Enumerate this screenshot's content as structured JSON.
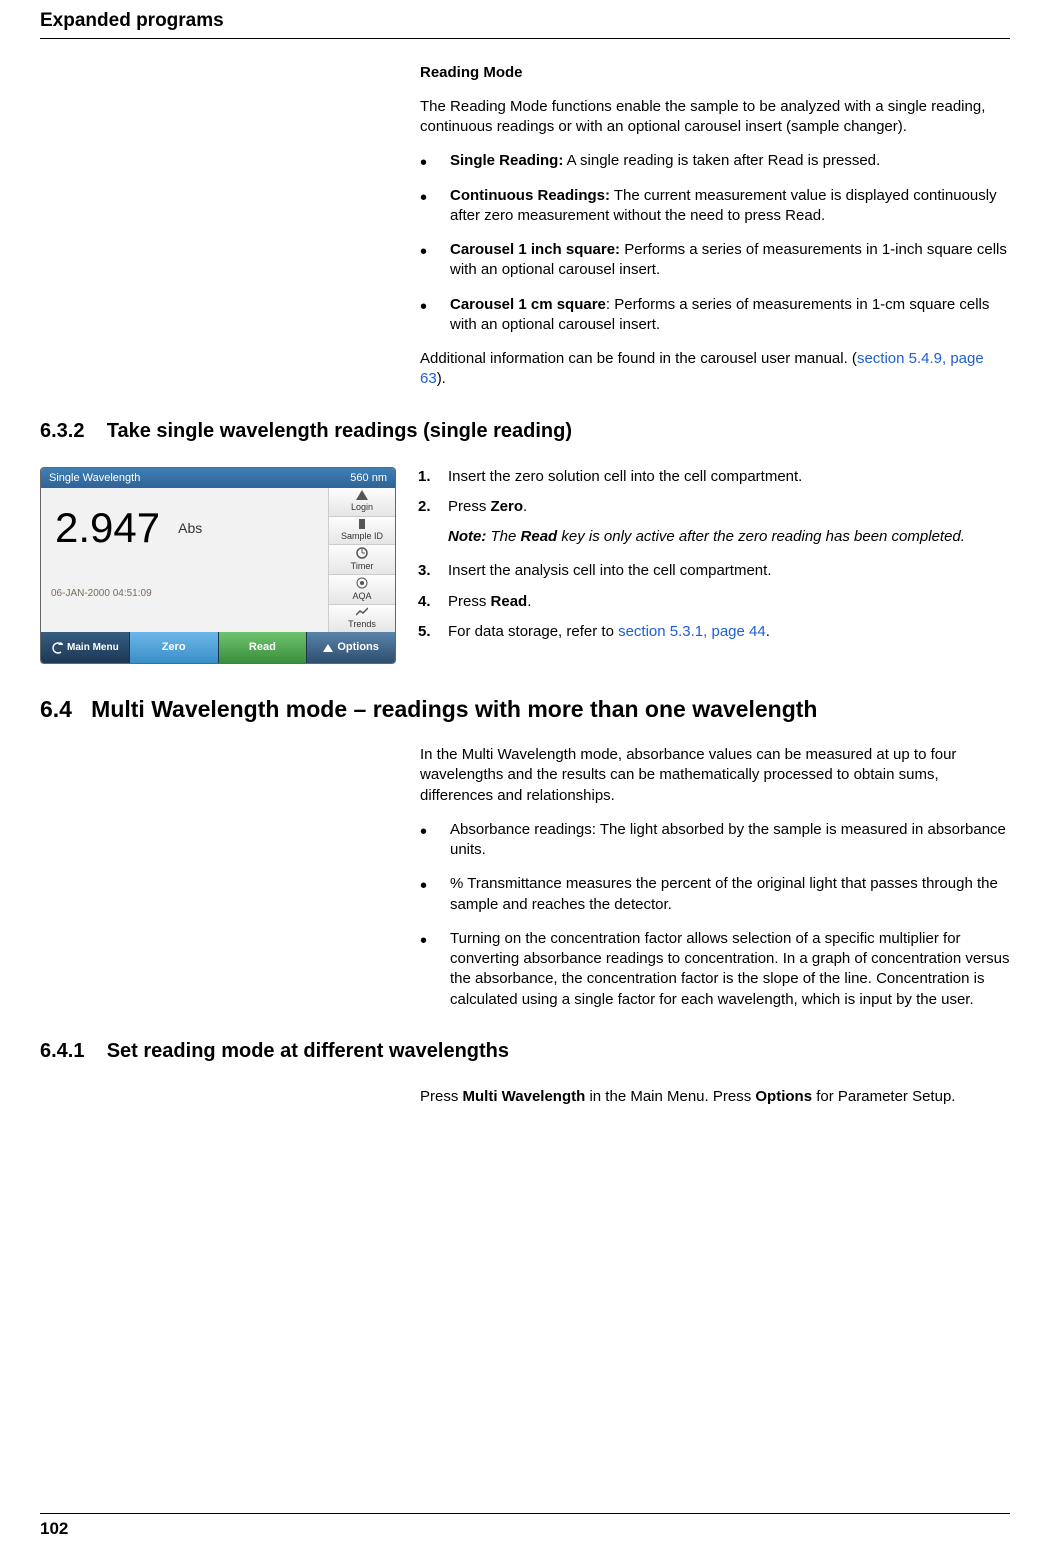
{
  "header_title": "Expanded programs",
  "page_number": "102",
  "reading_mode": {
    "title": "Reading Mode",
    "intro": "The Reading Mode functions enable the sample to be analyzed with a single reading, continuous readings or with an optional carousel insert (sample changer).",
    "items": [
      {
        "label": "Single Reading:",
        "text": " A single reading is taken after Read is pressed."
      },
      {
        "label": "Continuous Readings:",
        "text": " The current measurement value is displayed continuously after zero measurement without the need to press Read."
      },
      {
        "label": "Carousel 1 inch square:",
        "text": " Performs a series of measurements in 1-inch square cells with an optional carousel insert."
      },
      {
        "label": "Carousel 1 cm square",
        "text": ": Performs a series of measurements in 1-cm square cells with an optional carousel insert."
      }
    ],
    "outro_pre": "Additional information can be found in the carousel user manual. (",
    "xref": "section 5.4.9, page 63",
    "outro_post": ")."
  },
  "sec632": {
    "number": "6.3.2",
    "title": "Take single wavelength readings (single reading)",
    "steps": [
      {
        "n": "1.",
        "text": "Insert the zero solution cell into the cell compartment."
      },
      {
        "n": "2.",
        "pre": "Press ",
        "bold": "Zero",
        "post": "."
      },
      {
        "n": "3.",
        "text": "Insert the analysis cell into the cell compartment."
      },
      {
        "n": "4.",
        "pre": "Press ",
        "bold": "Read",
        "post": "."
      },
      {
        "n": "5.",
        "pre": "For data storage, refer to ",
        "xref": "section 5.3.1, page 44",
        "post": "."
      }
    ],
    "note_label": "Note:",
    "note_pre": " The ",
    "note_bold": "Read",
    "note_post": " key is only active after the zero reading has been completed."
  },
  "screenshot": {
    "title": "Single Wavelength",
    "wavelength": "560 nm",
    "value": "2.947",
    "unit": "Abs",
    "datetime": "06-JAN-2000  04:51:09",
    "side": [
      "Login",
      "Sample ID",
      "Timer",
      "AQA",
      "Trends"
    ],
    "footer": [
      "Main Menu",
      "Zero",
      "Read",
      "Options"
    ]
  },
  "sec64": {
    "number": "6.4",
    "title": "Multi Wavelength mode – readings with more than one wavelength",
    "intro": "In the Multi Wavelength mode, absorbance values can be measured at up to four wavelengths and the results can be mathematically processed to obtain sums, differences and relationships.",
    "bullets": [
      "Absorbance readings: The light absorbed by the sample is measured in absorbance units.",
      "% Transmittance measures the percent of the original light that passes through the sample and reaches the detector.",
      "Turning on the concentration factor allows selection of a specific multiplier for converting absorbance readings to concentration. In a graph of concentration versus the absorbance, the concentration factor is the slope of the line. Concentration is calculated using a single factor for each wavelength, which is input by the user."
    ]
  },
  "sec641": {
    "number": "6.4.1",
    "title": "Set reading mode at different wavelengths",
    "para_pre": "Press ",
    "para_b1": "Multi Wavelength",
    "para_mid": " in the Main Menu. Press ",
    "para_b2": "Options",
    "para_post": " for Parameter Setup."
  }
}
